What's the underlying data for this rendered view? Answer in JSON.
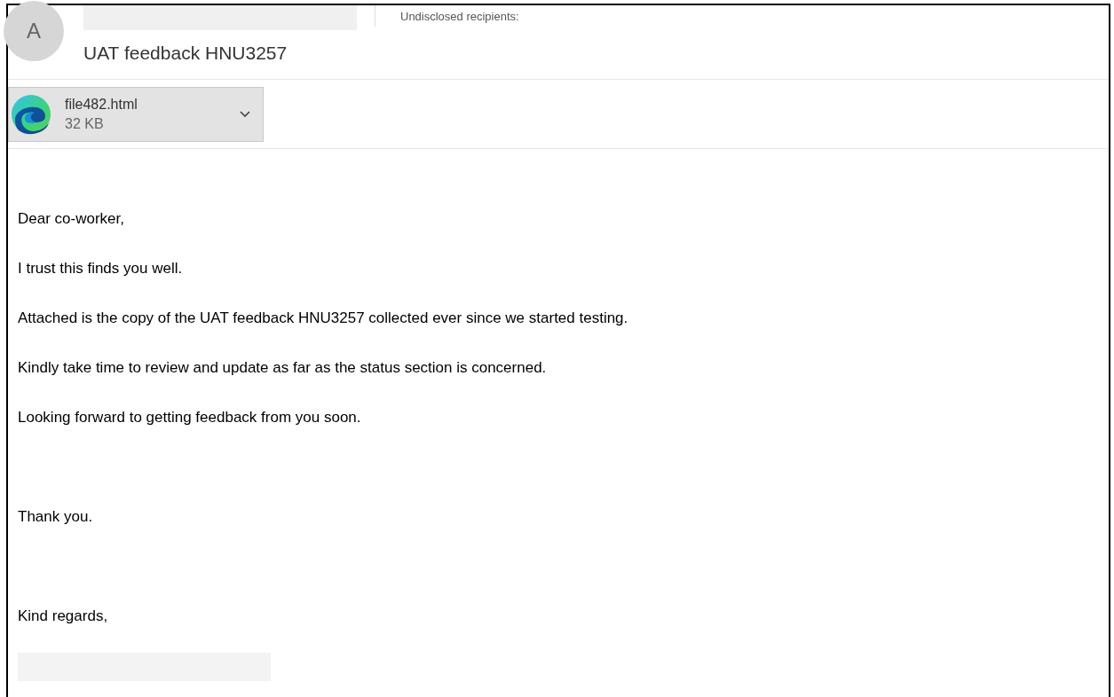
{
  "header": {
    "avatar": "A",
    "recipients": "Undisclosed recipients:",
    "subject": "UAT feedback HNU3257"
  },
  "attachment": {
    "name": "file482.html",
    "size": "32 KB"
  },
  "body": [
    {
      "kind": "line",
      "text": "Dear co-worker,"
    },
    {
      "kind": "line",
      "text": "I trust this finds you well."
    },
    {
      "kind": "line",
      "text": "Attached is the copy of the UAT feedback HNU3257 collected ever since we started testing."
    },
    {
      "kind": "line",
      "text": "Kindly take time to review and update as far as the status section is concerned."
    },
    {
      "kind": "line",
      "text": "Looking forward to getting feedback from you soon."
    },
    {
      "kind": "spaced",
      "text": "Thank you."
    },
    {
      "kind": "spaced",
      "text": "Kind regards,"
    }
  ]
}
